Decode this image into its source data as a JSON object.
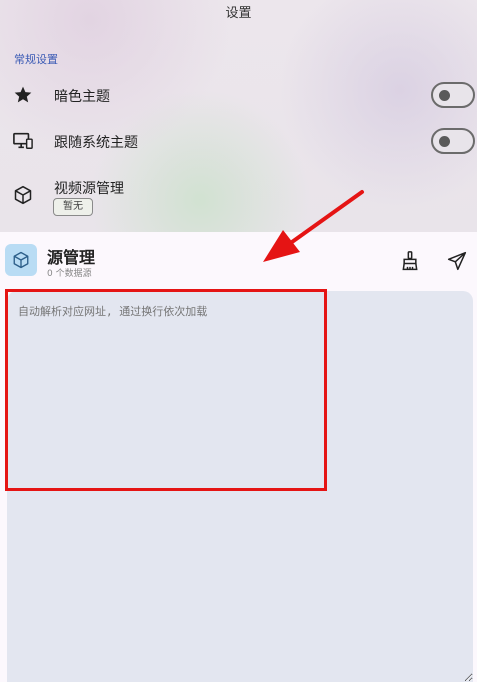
{
  "app": {
    "title": "设置"
  },
  "settings": {
    "section_label": "常规设置",
    "items": [
      {
        "label": "暗色主题",
        "icon": "star-icon",
        "toggle": "off"
      },
      {
        "label": "跟随系统主题",
        "icon": "monitor-icon",
        "toggle": "off"
      },
      {
        "label": "视频源管理",
        "icon": "box-icon",
        "badge": "暂无"
      }
    ]
  },
  "source_panel": {
    "title": "源管理",
    "subtitle": "0 个数据源",
    "icon": "box-icon",
    "actions": [
      {
        "name": "clear",
        "icon": "broom-icon"
      },
      {
        "name": "send",
        "icon": "send-icon"
      }
    ],
    "input": {
      "value": "",
      "placeholder": "自动解析对应网址, 通过换行依次加载"
    }
  },
  "annotations": {
    "highlight_color": "#e51414"
  }
}
